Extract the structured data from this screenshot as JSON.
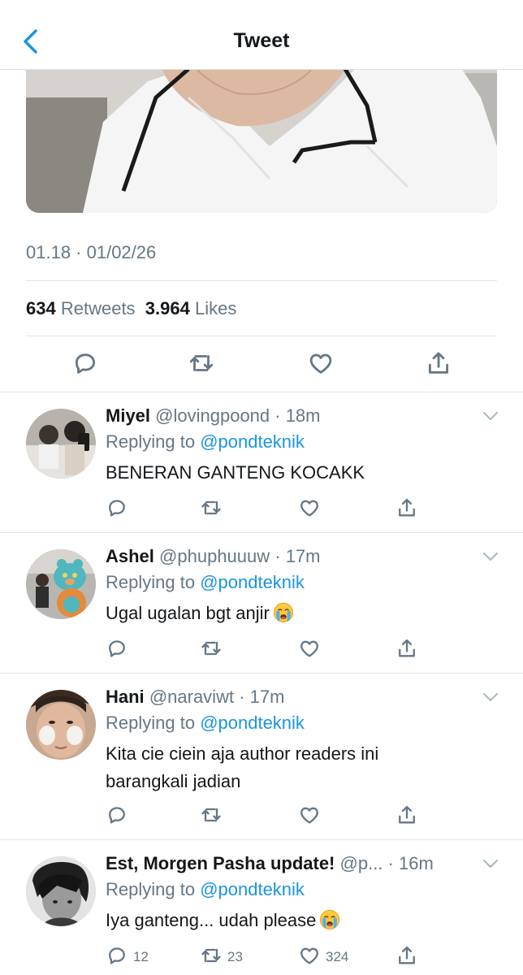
{
  "nav": {
    "title": "Tweet"
  },
  "tweet": {
    "timestamp": "01.18 · 01/02/26",
    "retweets_count": "634",
    "retweets_label": "Retweets",
    "likes_count": "3.964",
    "likes_label": "Likes"
  },
  "replies": [
    {
      "name": "Miyel",
      "meta": "@lovingpoond · 18m",
      "replying_prefix": "Replying to ",
      "replying_to": "@pondteknik",
      "text": "BENERAN GANTENG KOCAKK",
      "emoji": "",
      "reply_count": "",
      "retweet_count": "",
      "like_count": ""
    },
    {
      "name": "Ashel",
      "meta": "@phuphuuuw · 17m",
      "replying_prefix": "Replying to ",
      "replying_to": "@pondteknik",
      "text": "Ugal ugalan bgt anjir",
      "emoji": "loudly-crying-face",
      "reply_count": "",
      "retweet_count": "",
      "like_count": ""
    },
    {
      "name": "Hani",
      "meta": "@naraviwt · 17m",
      "replying_prefix": "Replying to ",
      "replying_to": "@pondteknik",
      "text": "Kita cie ciein aja author readers ini barangkali jadian",
      "emoji": "",
      "reply_count": "",
      "retweet_count": "",
      "like_count": ""
    },
    {
      "name": "Est, Morgen Pasha update!",
      "meta": "@p... · 16m",
      "replying_prefix": "Replying to ",
      "replying_to": "@pondteknik",
      "text": "Iya ganteng... udah please",
      "emoji": "loudly-crying-face",
      "reply_count": "12",
      "retweet_count": "23",
      "like_count": "324"
    }
  ],
  "colors": {
    "accent": "#1b95e0",
    "secondary_text": "#657786",
    "divider": "#e1e4e7"
  }
}
